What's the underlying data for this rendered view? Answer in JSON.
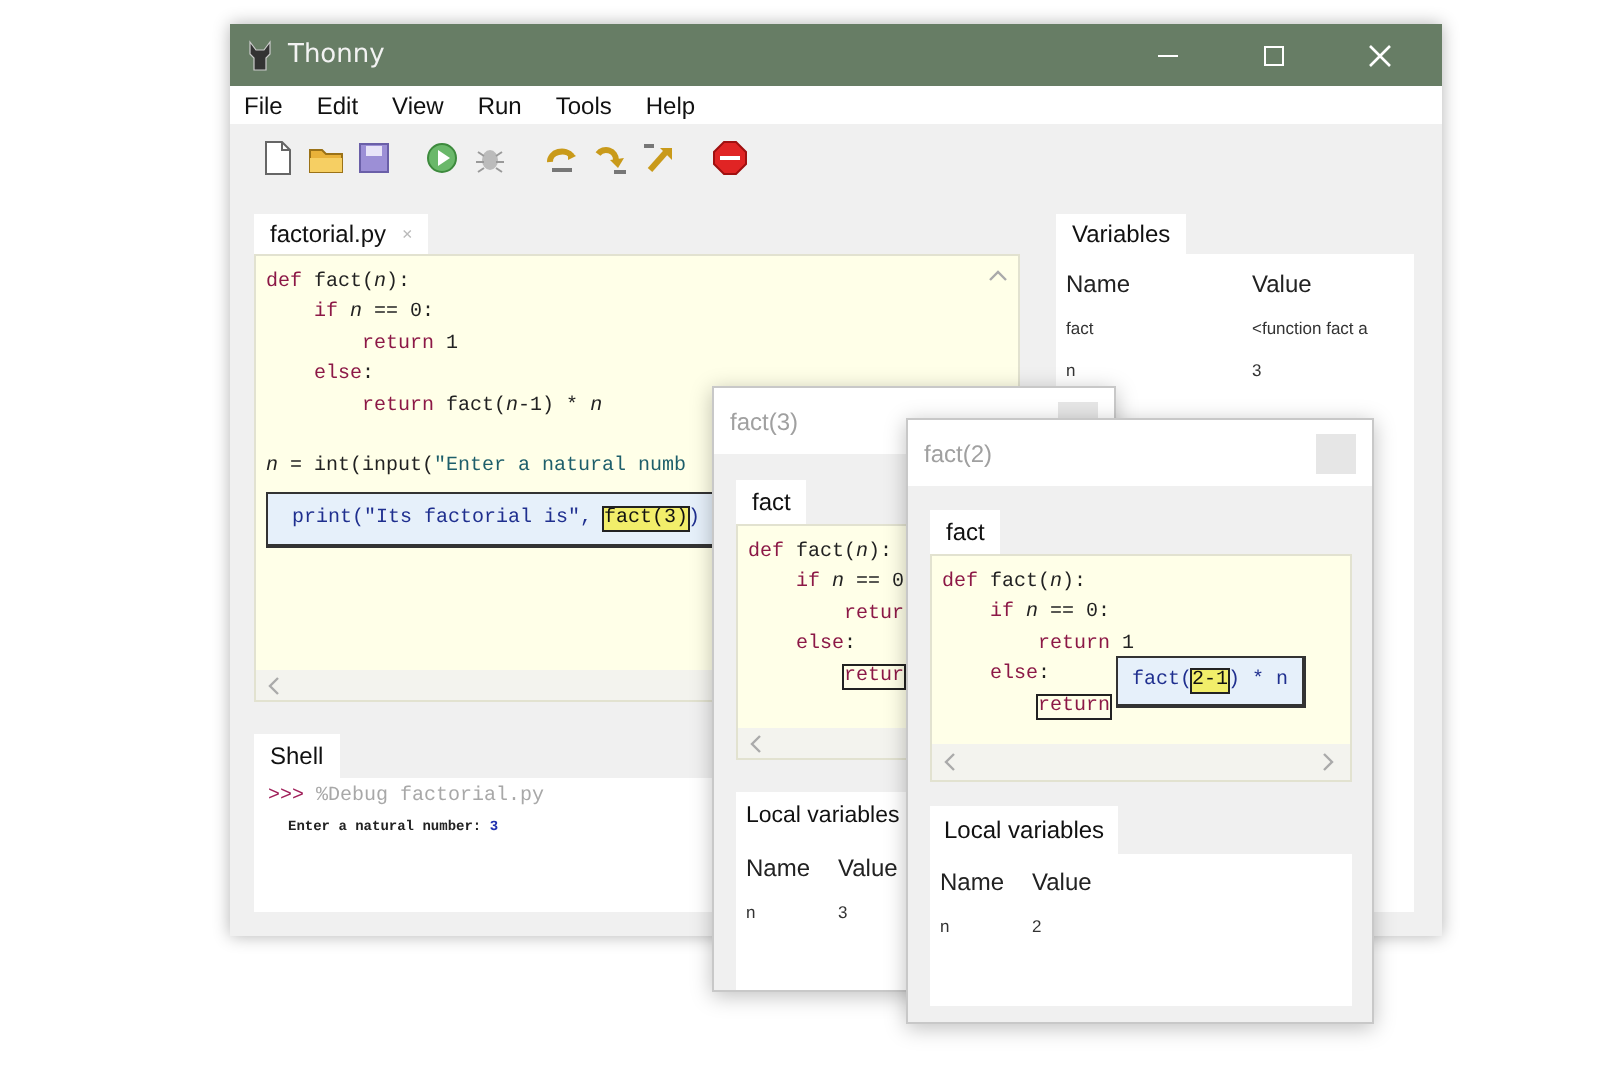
{
  "window": {
    "title": "Thonny"
  },
  "menu": [
    {
      "label": "File"
    },
    {
      "label": "Edit"
    },
    {
      "label": "View"
    },
    {
      "label": "Run"
    },
    {
      "label": "Tools"
    },
    {
      "label": "Help"
    }
  ],
  "editor": {
    "tab": "factorial.py",
    "tab_close": "×",
    "code": [
      {
        "tokens": [
          {
            "text": "def",
            "kind": "kw"
          },
          {
            "text": " fact(",
            "kind": "plain"
          },
          {
            "text": "n",
            "kind": "param"
          },
          {
            "text": "):",
            "kind": "plain"
          }
        ],
        "children": [
          {
            "tokens": [
              {
                "text": "if ",
                "kind": "kw"
              },
              {
                "text": "n",
                "kind": "param"
              },
              {
                "text": " == 0:",
                "kind": "plain"
              }
            ],
            "children": [
              {
                "tokens": [
                  {
                    "text": "return",
                    "kind": "kw"
                  },
                  {
                    "text": " 1",
                    "kind": "plain"
                  }
                ]
              }
            ]
          },
          {
            "tokens": [
              {
                "text": "else",
                "kind": "kw"
              },
              {
                "text": ":",
                "kind": "plain"
              }
            ],
            "children": [
              {
                "tokens": [
                  {
                    "text": "return",
                    "kind": "kw"
                  },
                  {
                    "text": " fact(",
                    "kind": "plain"
                  },
                  {
                    "text": "n",
                    "kind": "param"
                  },
                  {
                    "text": "-1) * ",
                    "kind": "plain"
                  },
                  {
                    "text": "n",
                    "kind": "param"
                  }
                ]
              }
            ]
          }
        ]
      },
      {
        "tokens": [
          {
            "text": "n",
            "kind": "param"
          },
          {
            "text": " = int(input(",
            "kind": "plain"
          },
          {
            "text": "\"Enter a natural numb",
            "kind": "str"
          }
        ]
      }
    ],
    "popup": [
      {
        "text": "print(\"Its factorial is\", ",
        "kind": "expr"
      },
      {
        "text": "fact(3)",
        "kind": "hl"
      },
      {
        "text": ")",
        "kind": "expr"
      }
    ]
  },
  "variables": {
    "title": "Variables",
    "columns": [
      "Name",
      "Value"
    ],
    "rows": [
      [
        "fact",
        "<function fact a"
      ],
      [
        "n",
        "3"
      ]
    ]
  },
  "shell": {
    "title": "Shell",
    "lines": [
      [
        {
          "text": ">>> ",
          "kind": "prompt"
        },
        {
          "text": "%Debug factorial.py",
          "kind": "cmd"
        }
      ],
      [
        {
          "text": "Enter a natural number: ",
          "kind": "out"
        },
        {
          "text": "3",
          "kind": "input"
        }
      ]
    ]
  },
  "frames": [
    {
      "title": "fact(3)",
      "tab": "fact",
      "code": [
        {
          "tokens": [
            {
              "text": "def",
              "kind": "kw"
            },
            {
              "text": " fact(",
              "kind": "plain"
            },
            {
              "text": "n",
              "kind": "param"
            },
            {
              "text": "):",
              "kind": "plain"
            }
          ],
          "children": [
            {
              "tokens": [
                {
                  "text": "if ",
                  "kind": "kw"
                },
                {
                  "text": "n",
                  "kind": "param"
                },
                {
                  "text": " == 0",
                  "kind": "plain"
                }
              ],
              "children": [
                {
                  "tokens": [
                    {
                      "text": "retur",
                      "kind": "kw"
                    }
                  ]
                }
              ]
            },
            {
              "tokens": [
                {
                  "text": "else",
                  "kind": "kw"
                },
                {
                  "text": ":",
                  "kind": "plain"
                }
              ],
              "children": [
                {
                  "tokens": [
                    {
                      "text": "retur",
                      "kind": "box"
                    }
                  ]
                }
              ]
            }
          ]
        }
      ],
      "locals": {
        "title": "Local variables",
        "columns": [
          "Name",
          "Value"
        ],
        "rows": [
          [
            "n",
            "3"
          ]
        ]
      }
    },
    {
      "title": "fact(2)",
      "tab": "fact",
      "code": [
        {
          "tokens": [
            {
              "text": "def",
              "kind": "kw"
            },
            {
              "text": " fact(",
              "kind": "plain"
            },
            {
              "text": "n",
              "kind": "param"
            },
            {
              "text": "):",
              "kind": "plain"
            }
          ],
          "children": [
            {
              "tokens": [
                {
                  "text": "if ",
                  "kind": "kw"
                },
                {
                  "text": "n",
                  "kind": "param"
                },
                {
                  "text": " == 0:",
                  "kind": "plain"
                }
              ],
              "children": [
                {
                  "tokens": [
                    {
                      "text": "return",
                      "kind": "kw"
                    },
                    {
                      "text": " 1",
                      "kind": "plain"
                    }
                  ]
                }
              ]
            },
            {
              "tokens": [
                {
                  "text": "else",
                  "kind": "kw"
                },
                {
                  "text": ":",
                  "kind": "plain"
                }
              ],
              "children": [
                {
                  "tokens": [
                    {
                      "text": "return",
                      "kind": "box"
                    }
                  ]
                }
              ]
            }
          ]
        }
      ],
      "popup": [
        {
          "text": "fact(",
          "kind": "expr"
        },
        {
          "text": "2-1",
          "kind": "hl"
        },
        {
          "text": ") * n",
          "kind": "expr"
        }
      ],
      "locals": {
        "title": "Local variables",
        "columns": [
          "Name",
          "Value"
        ],
        "rows": [
          [
            "n",
            "2"
          ]
        ]
      }
    }
  ]
}
